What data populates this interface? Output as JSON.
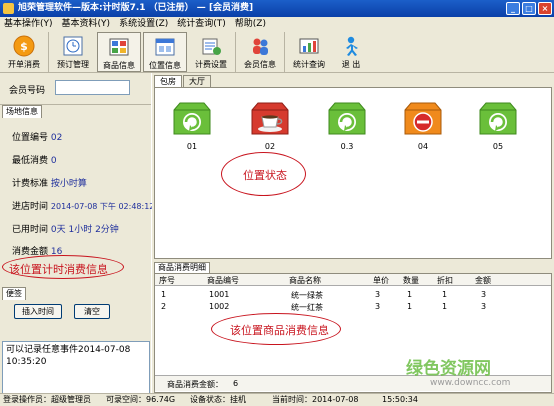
{
  "window": {
    "title": "旭荣管理软件—版本:计时版7.1 （已注册） — [会员消费]"
  },
  "menu": [
    "基本操作(Y)",
    "基本资料(Y)",
    "系统设置(Z)",
    "统计查询(T)",
    "帮助(Z)"
  ],
  "toolbar": [
    {
      "label": "开单消费",
      "icon": "coin-icon"
    },
    {
      "label": "预订管理",
      "icon": "clock-icon"
    },
    {
      "label": "商品信息",
      "icon": "grid-icon"
    },
    {
      "label": "位置信息",
      "icon": "window-icon"
    },
    {
      "label": "计费设置",
      "icon": "settings-icon"
    },
    {
      "label": "会员信息",
      "icon": "users-icon"
    },
    {
      "label": "统计查询",
      "icon": "chart-icon"
    },
    {
      "label": "退 出",
      "icon": "exit-icon"
    }
  ],
  "member": {
    "label": "会员号码",
    "value": ""
  },
  "site_info": {
    "tab": "场地信息",
    "rows": [
      {
        "label": "位置编号",
        "value": "02"
      },
      {
        "label": "最低消费",
        "value": "0"
      },
      {
        "label": "计费标准",
        "value": "按小时算"
      },
      {
        "label": "进店时间",
        "value": "2014-07-08 下午 02:48:12"
      },
      {
        "label": "已用时间",
        "value": "0天 1小时 2分钟"
      },
      {
        "label": "消费金额",
        "value": "16"
      }
    ]
  },
  "events": {
    "tab": "便签",
    "insert_time_label": "插入时间",
    "clear_label": "清空",
    "note": "可以记录任意事件2014-07-08\n10:35:20"
  },
  "room_tabs": [
    "包房",
    "大厅"
  ],
  "seats": [
    {
      "label": "01",
      "color": "#6abf3a",
      "icon": "refresh-icon"
    },
    {
      "label": "02",
      "color": "#d63a2e",
      "icon": "teacup-icon"
    },
    {
      "label": "0.3",
      "color": "#6abf3a",
      "icon": "refresh-icon"
    },
    {
      "label": "04",
      "color": "#f08a1c",
      "icon": "stop-icon"
    },
    {
      "label": "05",
      "color": "#6abf3a",
      "icon": "refresh-icon"
    }
  ],
  "annotations": {
    "position_status": "位置状态",
    "position_timing": "该位置计时消费信息",
    "position_goods": "该位置商品消费信息"
  },
  "detail": {
    "tab": "商品消费明细",
    "columns": [
      "序号",
      "商品编号",
      "商品名称",
      "单价",
      "数量",
      "折扣",
      "金额"
    ],
    "rows": [
      [
        "1",
        "1001",
        "统一绿茶",
        "3",
        "1",
        "1",
        "3"
      ],
      [
        "2",
        "1002",
        "统一红茶",
        "3",
        "1",
        "1",
        "3"
      ]
    ],
    "total_label": "商品消费金额：",
    "total_value": "6"
  },
  "status": [
    "登录操作员：超级管理员",
    "可录空间：96.74G",
    "设备状态：挂机",
    "当前时间：2014-07-08",
    "15:50:34"
  ],
  "watermark": {
    "text": "绿色资源网",
    "url": "www.downcc.com"
  }
}
